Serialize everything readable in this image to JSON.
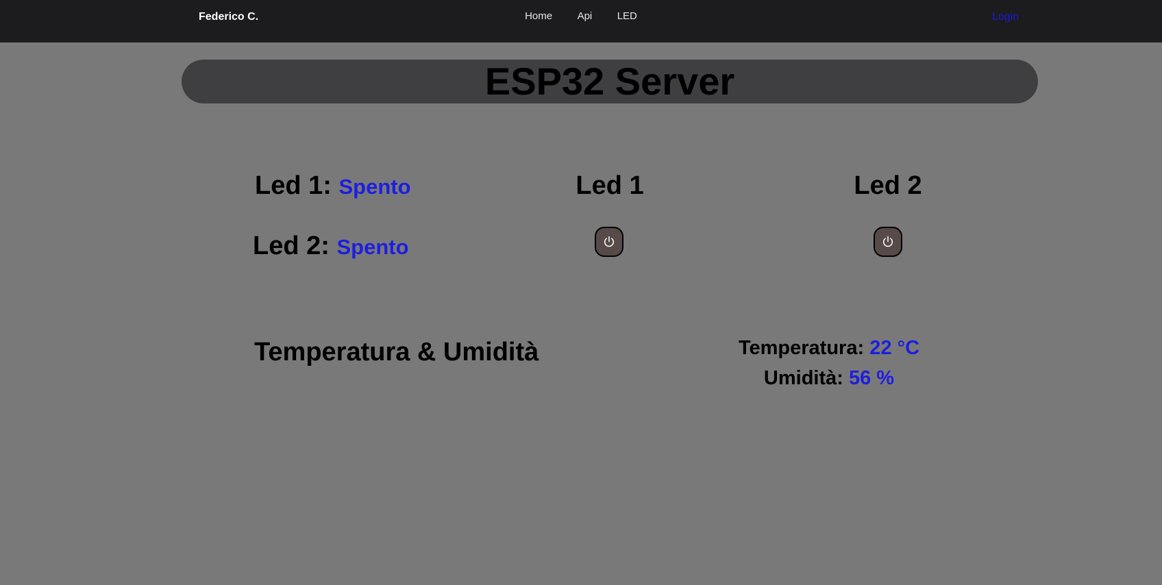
{
  "navbar": {
    "brand": "Federico C.",
    "links": [
      "Home",
      "Api",
      "LED"
    ],
    "login": "Login"
  },
  "header": {
    "title": "ESP32 Server"
  },
  "status": {
    "led1_label": "Led 1:",
    "led1_value": "Spento",
    "led2_label": "Led 2:",
    "led2_value": "Spento"
  },
  "controls": {
    "led1_title": "Led 1",
    "led2_title": "Led 2",
    "icon": "power-icon"
  },
  "sensors": {
    "section_title": "Temperatura & Umidità",
    "temperature_label": "Temperatura:",
    "temperature_value": "22 °C",
    "humidity_label": "Umidità:",
    "humidity_value": "56 %"
  },
  "colors": {
    "navbar_bg": "#1c1c1e",
    "page_bg": "#797979",
    "title_bar_bg": "#3f3e40",
    "accent_value": "#1d1ee0",
    "login_link": "#1a1ad6",
    "button_bg": "#574b49"
  }
}
